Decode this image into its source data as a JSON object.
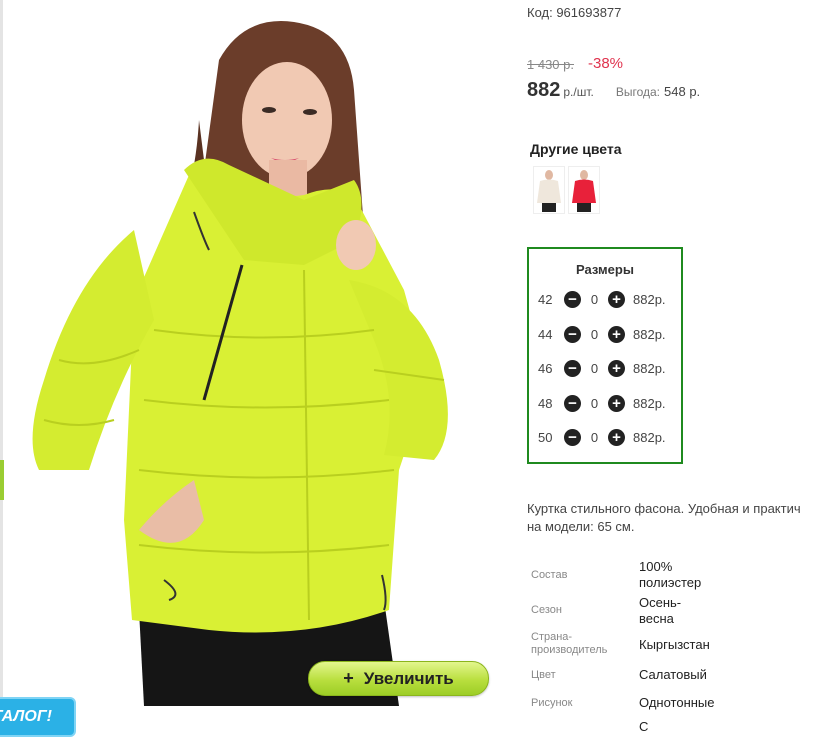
{
  "product": {
    "code": "Код: 961693877",
    "old_price": "1 430 р.",
    "discount": "-38%",
    "price": "882",
    "price_unit": "р./шт.",
    "savings_label": "Выгода:",
    "savings_value": "548 р."
  },
  "image": {
    "zoom_button": "Увеличить",
    "zoom_plus": "+",
    "catalog_badge": "ТАЛОГ!"
  },
  "other_colors": {
    "title": "Другие цвета",
    "swatches": [
      {
        "color": "#efe7dc",
        "name": "beige"
      },
      {
        "color": "#e8213a",
        "name": "red"
      }
    ]
  },
  "sizes": {
    "title": "Размеры",
    "rows": [
      {
        "size": "42",
        "qty": "0",
        "price": "882р."
      },
      {
        "size": "44",
        "qty": "0",
        "price": "882р."
      },
      {
        "size": "46",
        "qty": "0",
        "price": "882р."
      },
      {
        "size": "48",
        "qty": "0",
        "price": "882р."
      },
      {
        "size": "50",
        "qty": "0",
        "price": "882р."
      }
    ],
    "minus": "−",
    "plus": "+"
  },
  "description": {
    "line1": "Куртка стильного фасона. Удобная и практич",
    "line2": "на модели: 65 см."
  },
  "attributes": [
    {
      "label": "Состав",
      "value_lines": [
        "100%",
        "полиэстер"
      ]
    },
    {
      "label": "Сезон",
      "value_lines": [
        "Осень-",
        "весна"
      ]
    },
    {
      "label_lines": [
        "Страна-",
        "производитель"
      ],
      "value_lines": [
        "Кыргызстан"
      ]
    },
    {
      "label": "Цвет",
      "value_lines": [
        "Салатовый"
      ]
    },
    {
      "label": "Рисунок",
      "value_lines": [
        "Однотонные"
      ]
    },
    {
      "label": "",
      "value_lines": [
        "С"
      ]
    }
  ],
  "colors": {
    "accent_green": "#1f8a1f",
    "discount_red": "#e0334e",
    "jacket": "#d9f034"
  }
}
